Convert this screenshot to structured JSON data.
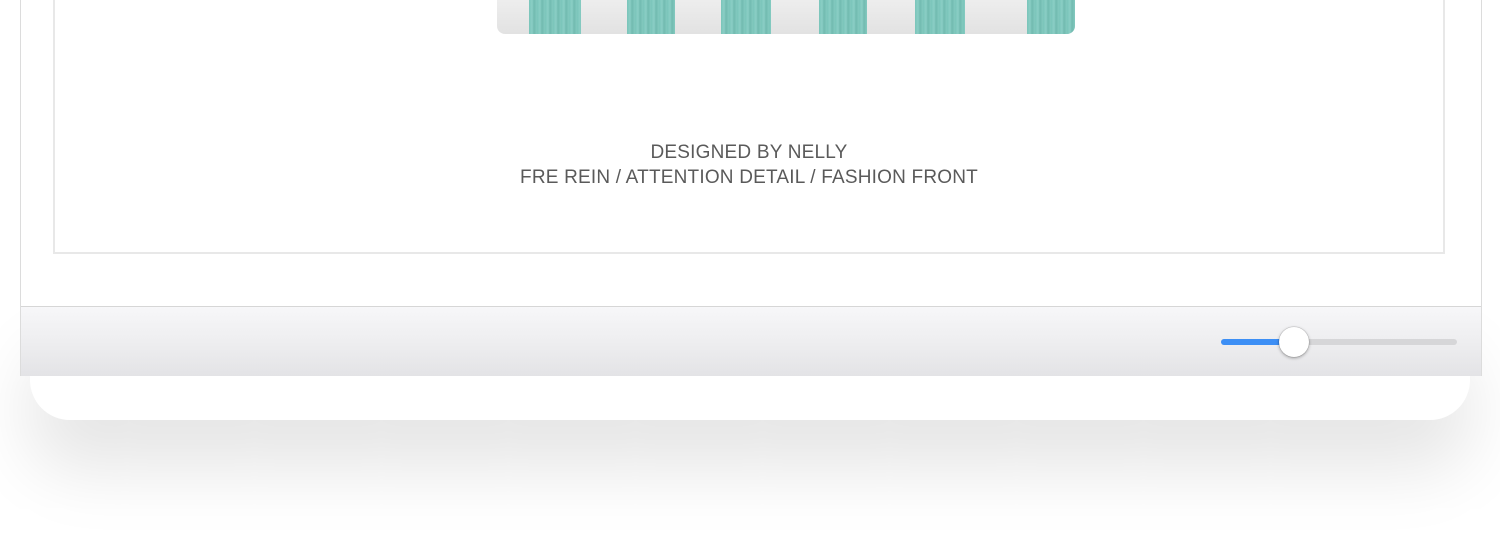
{
  "footer": {
    "designer_line": "DESIGNED BY NELLY",
    "tags_line": "FRE REIN / ATTENTION DETAIL / FASHION FRONT"
  },
  "zoom_slider": {
    "value": 0.31,
    "fill_color": "#3d8ff5",
    "track_color": "#d6d6d8"
  },
  "colors": {
    "fabric_stripe": "#74c2b7",
    "caption_text": "#5a5a5a"
  }
}
